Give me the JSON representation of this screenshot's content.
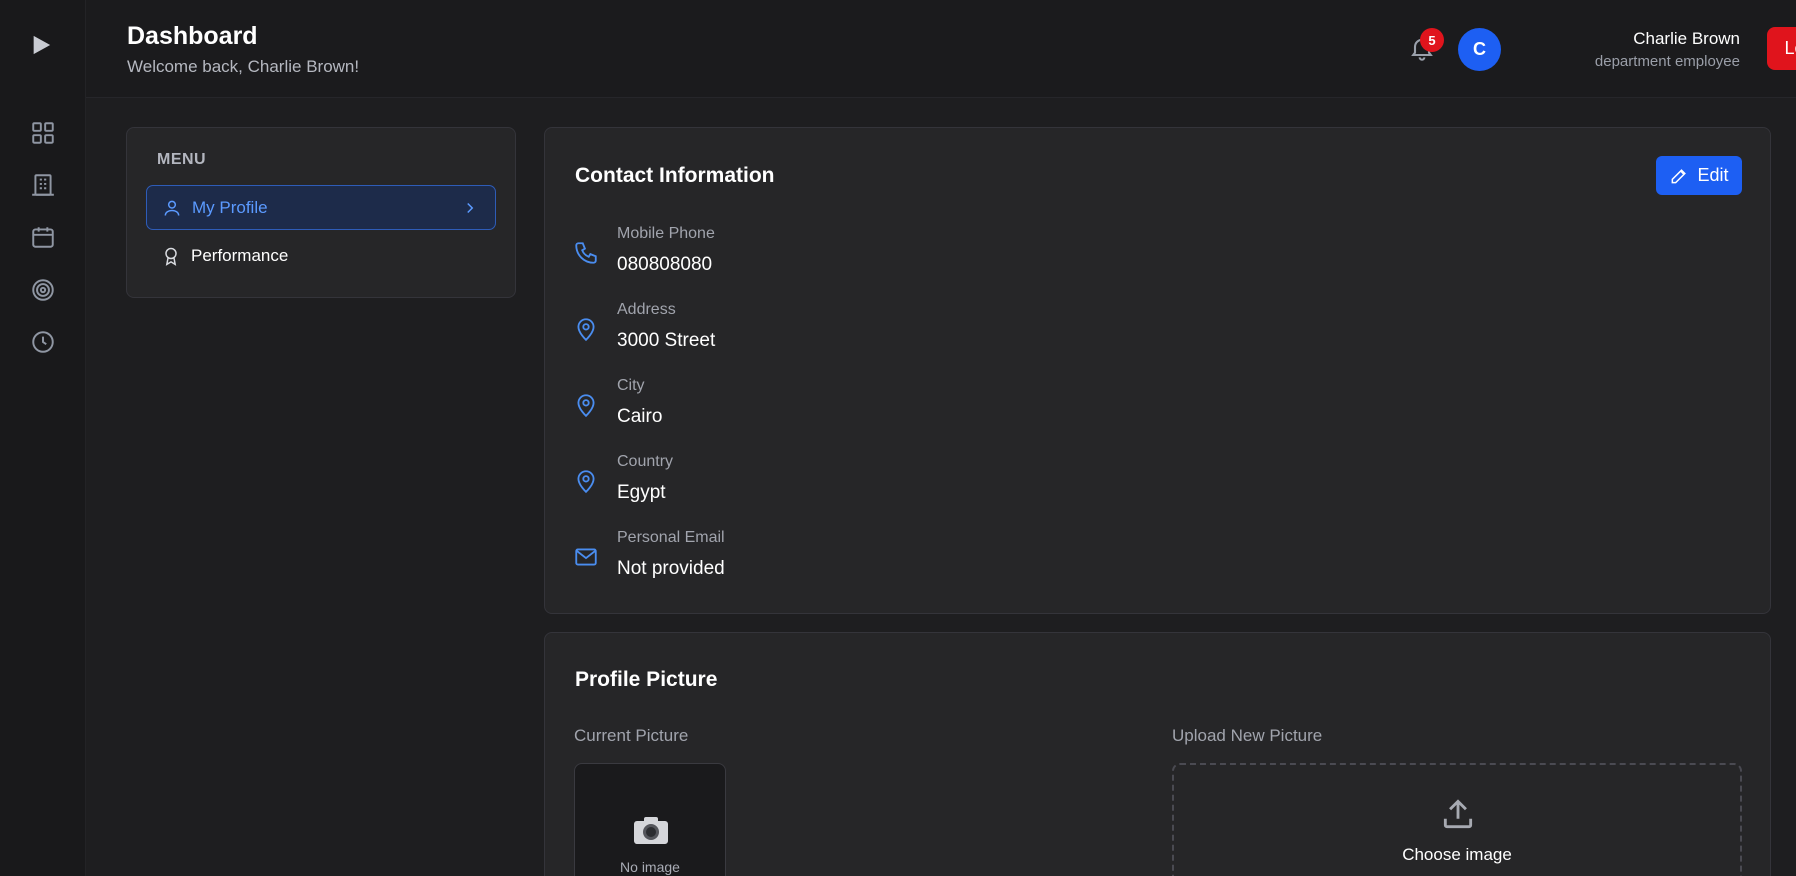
{
  "header": {
    "title": "Dashboard",
    "subtitle": "Welcome back, Charlie Brown!",
    "notification_count": "5",
    "avatar_initial": "C",
    "user_name": "Charlie Brown",
    "user_role": "department employee",
    "logout_label": "Logout"
  },
  "rail": {
    "icons": [
      "play-icon",
      "grid-icon",
      "building-icon",
      "calendar-icon",
      "target-icon",
      "clock-icon"
    ]
  },
  "menu": {
    "title": "MENU",
    "items": [
      {
        "label": "My Profile",
        "icon": "user-icon",
        "active": true
      },
      {
        "label": "Performance",
        "icon": "award-icon",
        "active": false
      }
    ]
  },
  "contact": {
    "title": "Contact Information",
    "edit_label": "Edit",
    "fields": [
      {
        "label": "Mobile Phone",
        "value": "080808080",
        "icon": "phone-icon"
      },
      {
        "label": "Address",
        "value": "3000 Street",
        "icon": "map-pin-icon"
      },
      {
        "label": "City",
        "value": "Cairo",
        "icon": "map-pin-icon"
      },
      {
        "label": "Country",
        "value": "Egypt",
        "icon": "map-pin-icon"
      },
      {
        "label": "Personal Email",
        "value": "Not provided",
        "icon": "mail-icon"
      }
    ]
  },
  "picture": {
    "title": "Profile Picture",
    "current_label": "Current Picture",
    "no_image_text": "No image",
    "upload_label": "Upload New Picture",
    "choose_label": "Choose image"
  },
  "colors": {
    "accent": "#1d5ff3",
    "danger": "#e0141c",
    "link": "#5b9aff",
    "icon_blue": "#4a8df0"
  }
}
